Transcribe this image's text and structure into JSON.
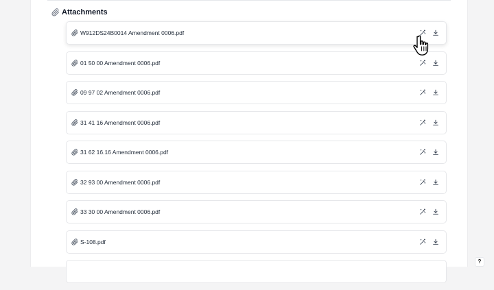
{
  "attachments": {
    "title": "Attachments",
    "title_icon": "paperclip-icon",
    "items": [
      {
        "name": "W912DS24B0014 Amendment 0006.pdf"
      },
      {
        "name": "01 50 00 Amendment 0006.pdf"
      },
      {
        "name": "09 97 02 Amendment 0006.pdf"
      },
      {
        "name": "31 41 16 Amendment 0006.pdf"
      },
      {
        "name": "31 62 16.16 Amendment 0006.pdf"
      },
      {
        "name": "32 93 00 Amendment 0006.pdf"
      },
      {
        "name": "33 30 00 Amendment 0006.pdf"
      },
      {
        "name": "S-108.pdf"
      },
      {
        "name": ""
      }
    ]
  },
  "help": {
    "label": "?"
  },
  "colors": {
    "accent": "#1f2328",
    "border": "#e6e7ea",
    "background": "#f4f4f5"
  }
}
